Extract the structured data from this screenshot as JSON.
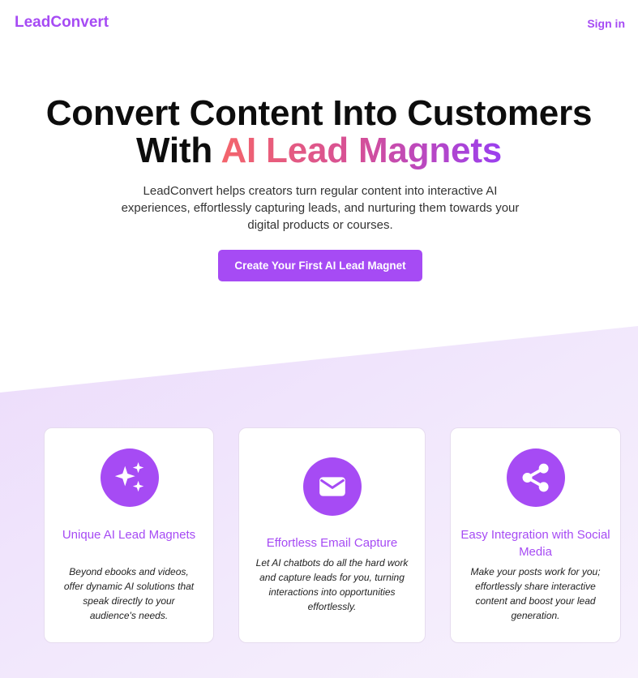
{
  "header": {
    "logo": "LeadConvert",
    "signin": "Sign in"
  },
  "hero": {
    "title_line1": "Convert Content Into Customers",
    "title_line2_prefix": "With ",
    "title_line2_highlight": "AI Lead Magnets",
    "subtitle": "LeadConvert helps creators turn regular content into interactive AI experiences, effortlessly capturing leads, and nurturing them towards your digital products or courses.",
    "cta_label": "Create Your First AI Lead Magnet"
  },
  "colors": {
    "accent": "#a64bf4",
    "gradient_start": "#f4656b",
    "gradient_end": "#9a3ff0",
    "band": "#efe3fc"
  },
  "features": [
    {
      "icon": "sparkles-icon",
      "title": "Unique AI Lead Magnets",
      "description": "Beyond ebooks and videos, offer dynamic AI solutions that speak directly to your audience's needs."
    },
    {
      "icon": "envelope-icon",
      "title": "Effortless Email Capture",
      "description": "Let AI chatbots do all the hard work and capture leads for you, turning interactions into opportunities effortlessly."
    },
    {
      "icon": "share-icon",
      "title": "Easy Integration with Social Media",
      "description": "Make your posts work for you; effortlessly share interactive content and boost your lead generation."
    }
  ]
}
